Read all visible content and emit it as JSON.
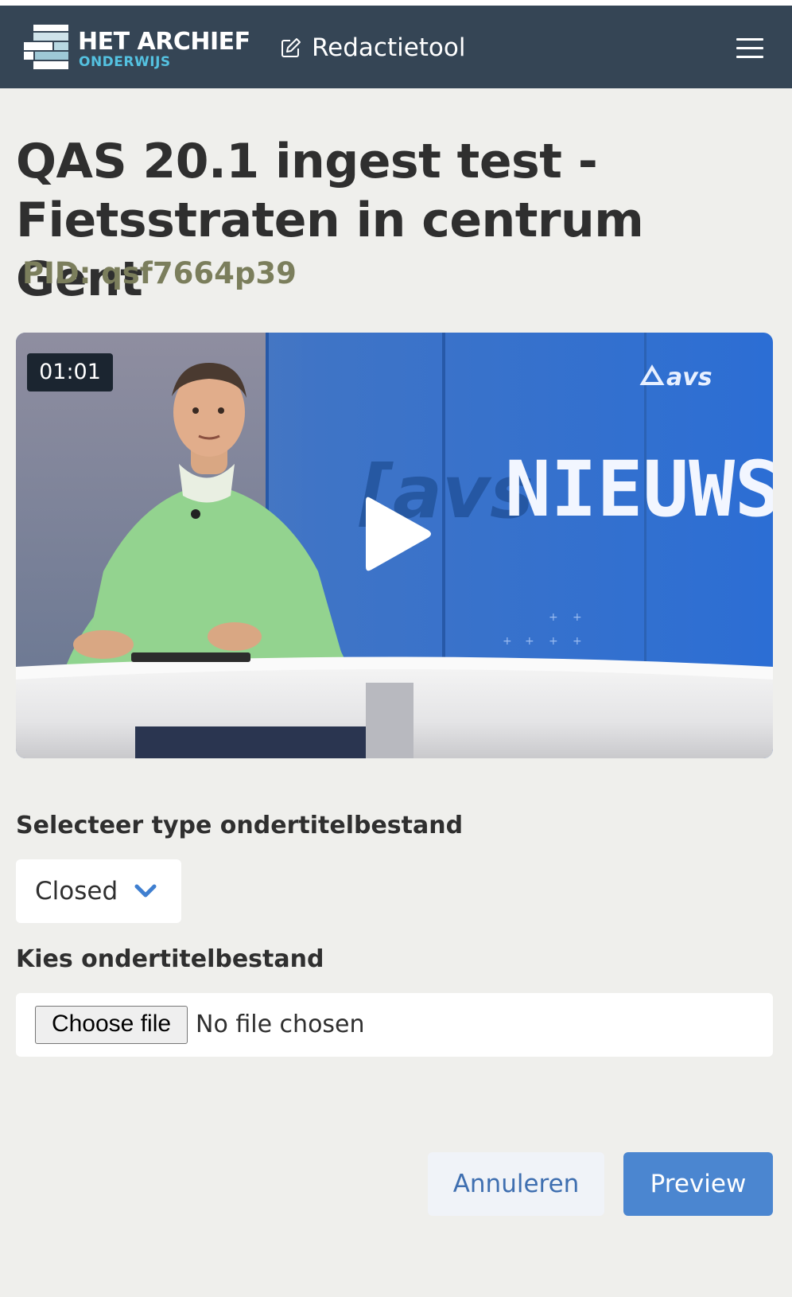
{
  "header": {
    "logo_line1": "HET ARCHIEF",
    "logo_line2": "ONDERWIJS",
    "tool_label": "Redactietool",
    "menu_icon": "hamburger-icon"
  },
  "page": {
    "title": "QAS 20.1 ingest test - Fietsstraten in centrum Gent",
    "pid": "PID: qsf7664p39"
  },
  "video": {
    "duration": "01:01",
    "thumbnail_brand": "avs",
    "thumbnail_headline": "NIEUWS",
    "play_icon": "play-icon"
  },
  "form": {
    "subtitle_type_label": "Selecteer type ondertitelbestand",
    "subtitle_type_value": "Closed",
    "subtitle_file_label": "Kies ondertitelbestand",
    "file_button_label": "Choose file",
    "file_status": "No file chosen"
  },
  "actions": {
    "cancel_label": "Annuleren",
    "preview_label": "Preview"
  },
  "colors": {
    "navbar": "#354555",
    "accent": "#4b86d0",
    "pid": "#7b7e5c",
    "background": "#efefec"
  }
}
